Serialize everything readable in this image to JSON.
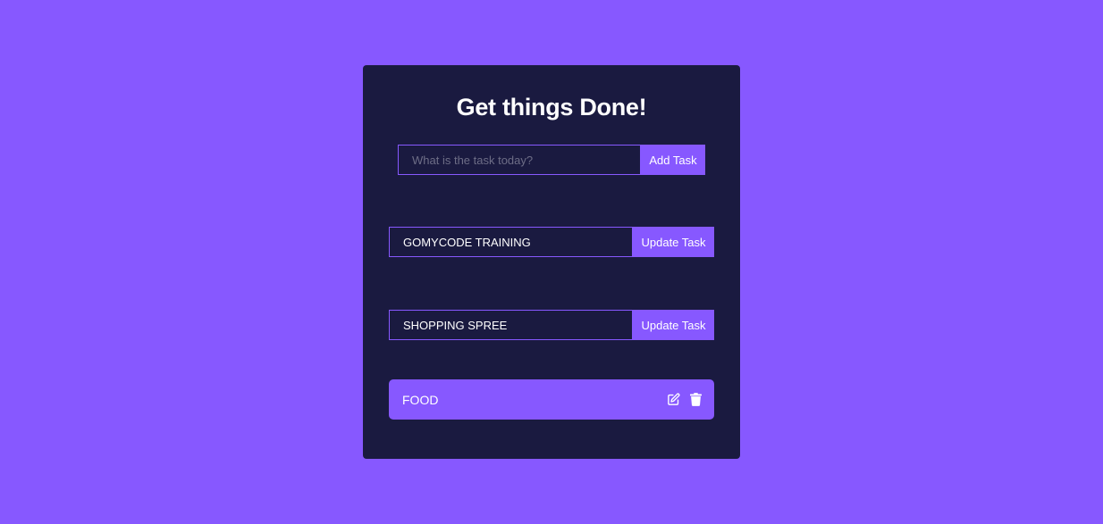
{
  "app": {
    "title": "Get things Done!"
  },
  "add_form": {
    "placeholder": "What is the task today?",
    "value": "",
    "button_label": "Add Task"
  },
  "edit_forms": [
    {
      "value": "GOMYCODE TRAINING",
      "button_label": "Update Task"
    },
    {
      "value": "SHOPPING SPREE",
      "button_label": "Update Task"
    }
  ],
  "todos": [
    {
      "label": "FOOD",
      "actions": [
        "edit-icon",
        "trash-icon"
      ]
    }
  ],
  "colors": {
    "page_background": "#8758ff",
    "card_background": "#1a1a40",
    "accent": "#8758ff",
    "text": "#ffffff"
  }
}
